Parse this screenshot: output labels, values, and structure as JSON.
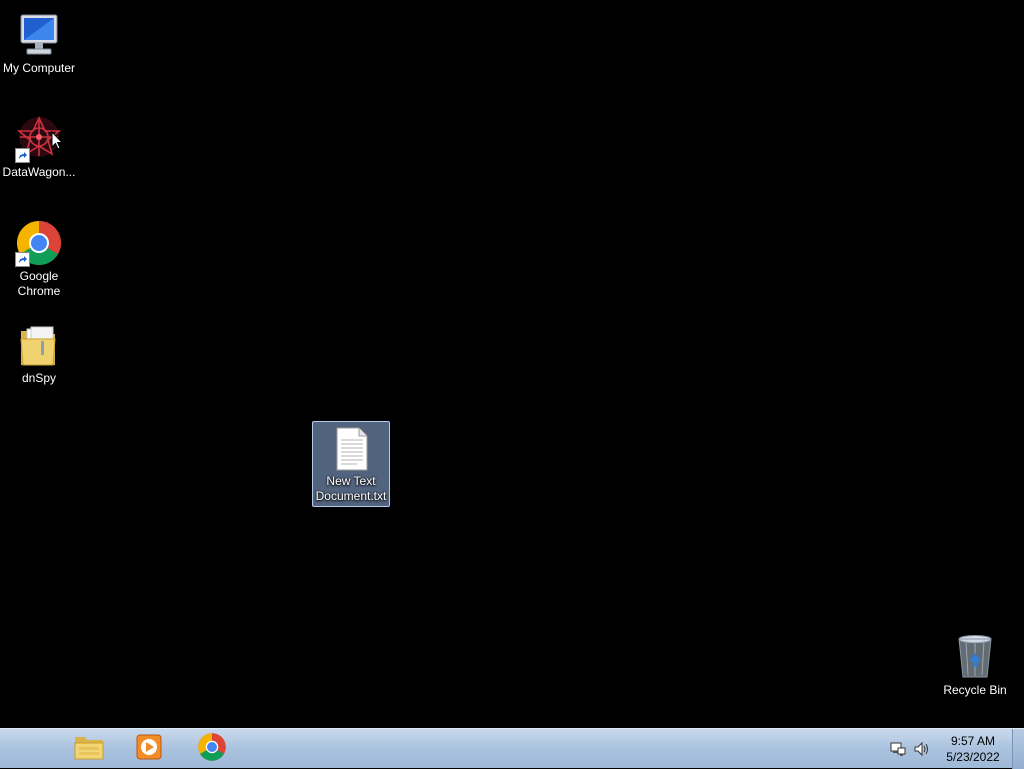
{
  "desktop": {
    "background_color": "#000000",
    "icons": [
      {
        "label": "My Computer",
        "icon": "computer-icon",
        "shortcut": false,
        "selected": false
      },
      {
        "label": "DataWagon...",
        "icon": "datawagon-icon",
        "shortcut": true,
        "selected": false
      },
      {
        "label": "Google\nChrome",
        "icon": "chrome-icon",
        "shortcut": true,
        "selected": false
      },
      {
        "label": "dnSpy",
        "icon": "folder-icon",
        "shortcut": false,
        "selected": false
      },
      {
        "label": "New Text\nDocument.txt",
        "icon": "text-document-icon",
        "shortcut": false,
        "selected": true
      },
      {
        "label": "Recycle Bin",
        "icon": "recycle-bin-icon",
        "shortcut": false,
        "selected": false
      }
    ]
  },
  "taskbar": {
    "pinned": [
      {
        "name": "File Explorer",
        "icon": "file-explorer-icon"
      },
      {
        "name": "Media Player",
        "icon": "media-player-icon"
      },
      {
        "name": "Google Chrome",
        "icon": "chrome-icon"
      }
    ],
    "tray": {
      "icons": [
        "network-icon",
        "volume-icon"
      ],
      "time": "9:57 AM",
      "date": "5/23/2022"
    }
  },
  "colors": {
    "selection": "#96b4e6",
    "taskbar": "#aac2de"
  }
}
